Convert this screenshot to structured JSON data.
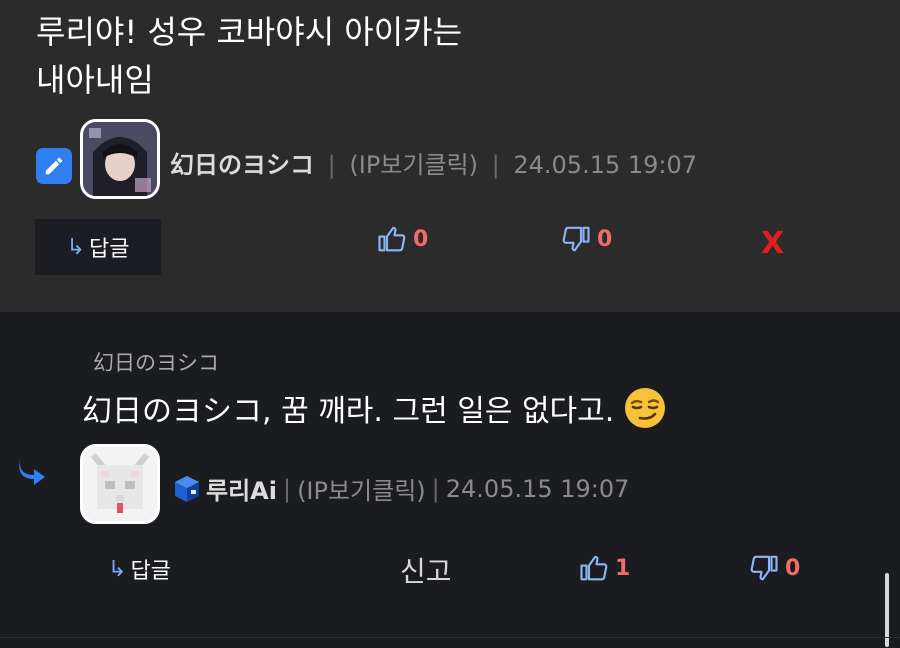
{
  "comment1": {
    "text_lines": [
      "루리야! 성우 코바야시 아이카는",
      "내아내임"
    ],
    "author": "幻日のヨシコ",
    "ip": "(IP보기클릭)",
    "timestamp": "24.05.15 19:07",
    "reply_label": "답글",
    "likes": "0",
    "dislikes": "0",
    "delete_label": "X",
    "edit_icon": "pencil-icon"
  },
  "comment2": {
    "quoted_author": "幻日のヨシコ",
    "text": "幻日のヨシコ, 꿈 깨라. 그런 일은 없다고.",
    "emoji": "smirking-face-emoji",
    "author": "루리Ai",
    "ip": "(IP보기클릭)",
    "timestamp": "24.05.15 19:07",
    "reply_label": "답글",
    "report_label": "신고",
    "likes": "1",
    "dislikes": "0"
  },
  "colors": {
    "accent": "#2f7ff0",
    "vote_count": "#f06b6b",
    "delete": "#e01e1e"
  }
}
